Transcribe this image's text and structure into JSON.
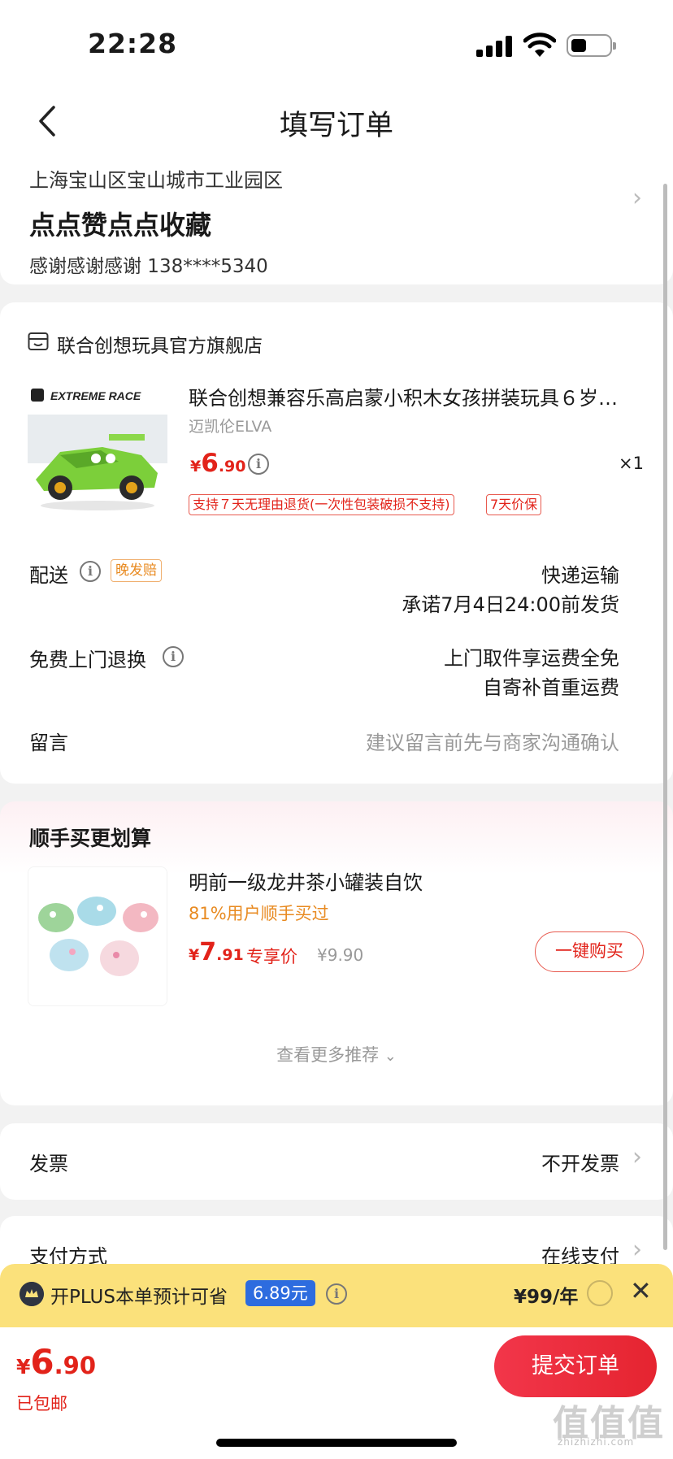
{
  "status_bar": {
    "time": "22:28"
  },
  "header": {
    "title": "填写订单"
  },
  "address": {
    "region": "上海宝山区宝山城市工业园区",
    "detail": "点点赞点点收藏",
    "contact": "感谢感谢感谢  138****5340"
  },
  "store": {
    "name": "联合创想玩具官方旗舰店"
  },
  "product": {
    "image_logo": "EXTREME RACE",
    "title": "联合创想兼容乐高启蒙小积木女孩拼装玩具６岁…",
    "brand": "迈凯伦ELVA",
    "price_currency": "¥",
    "price_int": "6",
    "price_dec": ".90",
    "qty": "×1",
    "tags": [
      "支持７天无理由退货(一次性包装破损不支持)",
      "7天价保"
    ]
  },
  "delivery": {
    "label": "配送",
    "badge": "晚发赔",
    "method": "快递运输",
    "promise": "承诺7月4日24:00前发货"
  },
  "returns": {
    "label": "免费上门退换",
    "line1": "上门取件享运费全免",
    "line2": "自寄补首重运费"
  },
  "message": {
    "label": "留言",
    "placeholder": "建议留言前先与商家沟通确认"
  },
  "recommend": {
    "title": "顺手买更划算",
    "item_name": "明前一级龙井茶小罐装自饮",
    "item_sub": "81%用户顺手买过",
    "price_currency": "¥",
    "price_int": "7",
    "price_dec": ".91",
    "exclusive": "专享价",
    "original": "¥9.90",
    "buy_button": "一键购买",
    "more": "查看更多推荐"
  },
  "invoice": {
    "label": "发票",
    "value": "不开发票"
  },
  "payment": {
    "label": "支付方式",
    "value": "在线支付"
  },
  "plus_banner": {
    "text": "开PLUS本单预计可省",
    "saving": "6.89元",
    "price": "¥99/年"
  },
  "footer": {
    "total_currency": "¥",
    "total_int": "6",
    "total_dec": ".90",
    "shipping": "已包邮",
    "submit": "提交订单",
    "watermark": "值值值",
    "watermark_sub": "zhizhizhi.com"
  },
  "colors": {
    "accent": "#e2231a",
    "plus_bg": "#fbe17b",
    "badge_blue": "#2d6cdf"
  }
}
